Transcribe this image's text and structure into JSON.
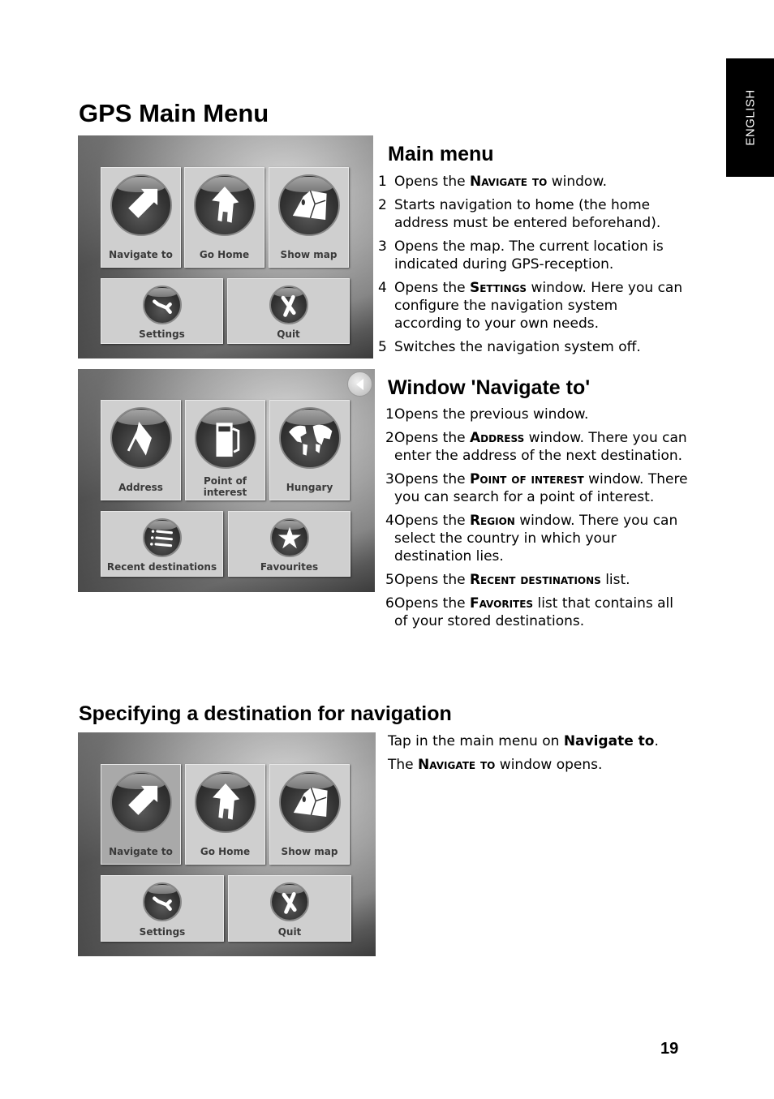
{
  "side_tab": {
    "label": "ENGLISH"
  },
  "page_title": "GPS Main Menu",
  "page_number": "19",
  "main_menu": {
    "heading": "Main menu",
    "screenshot": {
      "tiles": [
        {
          "label": "Navigate to",
          "icon": "arrow-icon"
        },
        {
          "label": "Go Home",
          "icon": "house-icon"
        },
        {
          "label": "Show map",
          "icon": "map-icon"
        },
        {
          "label": "Settings",
          "icon": "wrench-icon"
        },
        {
          "label": "Quit",
          "icon": "cross-icon"
        }
      ]
    },
    "items": [
      {
        "num": "1",
        "pre": "Opens the ",
        "em": "Navigate to",
        "post": " window."
      },
      {
        "num": "2",
        "pre": "Starts navigation to home (the home address must be entered beforehand).",
        "em": "",
        "post": ""
      },
      {
        "num": "3",
        "pre": "Opens the map. The current location is indicated during GPS-reception.",
        "em": "",
        "post": ""
      },
      {
        "num": "4",
        "pre": "Opens the ",
        "em": "Settings",
        "post": " window. Here you can configure the navigation system according to your own needs."
      },
      {
        "num": "5",
        "pre": "Switches the navigation system off.",
        "em": "",
        "post": ""
      }
    ]
  },
  "navigate_window": {
    "heading": "Window 'Navigate to'",
    "screenshot": {
      "back_icon": "back-arrow-icon",
      "tiles": [
        {
          "label": "Address",
          "icon": "flag-icon"
        },
        {
          "label": "Point of interest",
          "icon": "fuel-pump-icon"
        },
        {
          "label": "Hungary",
          "icon": "globe-icon"
        },
        {
          "label": "Recent destinations",
          "icon": "list-icon"
        },
        {
          "label": "Favourites",
          "icon": "star-icon"
        }
      ]
    },
    "items": [
      {
        "num": "1",
        "pre": "Opens the previous window.",
        "em": "",
        "post": ""
      },
      {
        "num": "2",
        "pre": "Opens the ",
        "em": "Address",
        "post": " window. There you can enter the address of the next destination."
      },
      {
        "num": "3",
        "pre": "Opens the ",
        "em": "Point of interest",
        "post": " window. There you can search for a point of interest."
      },
      {
        "num": "4",
        "pre": "Opens the ",
        "em": "Region",
        "post": " window. There you can select the country in which your destination lies."
      },
      {
        "num": "5",
        "pre": "Opens the ",
        "em": "Recent destinations",
        "post": " list."
      },
      {
        "num": "6",
        "pre": "Opens the ",
        "em": "Favorites",
        "post": " list that contains all of your stored destinations."
      }
    ]
  },
  "specifying": {
    "heading": "Specifying a destination for navigation",
    "screenshot": {
      "pressed_tile": "Navigate to",
      "tiles": [
        {
          "label": "Navigate to",
          "icon": "arrow-icon"
        },
        {
          "label": "Go Home",
          "icon": "house-icon"
        },
        {
          "label": "Show map",
          "icon": "map-icon"
        },
        {
          "label": "Settings",
          "icon": "wrench-icon"
        },
        {
          "label": "Quit",
          "icon": "cross-icon"
        }
      ]
    },
    "para1": {
      "pre": "Tap in the main menu on ",
      "bold": "Navigate to",
      "post": "."
    },
    "para2": {
      "pre": "The ",
      "em": "Navigate to",
      "post": " window opens."
    }
  }
}
